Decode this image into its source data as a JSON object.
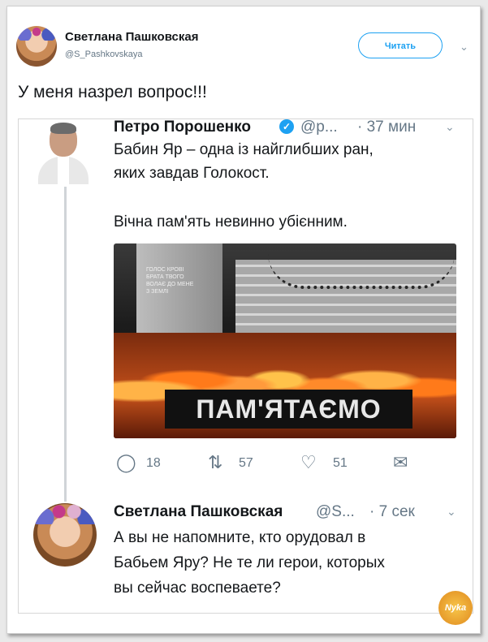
{
  "header": {
    "name": "Светлана Пашковская",
    "handle": "@S_Pashkovskaya",
    "follow_label": "Читать",
    "menu_icon": "chevron-down-icon"
  },
  "main_tweet": {
    "text": "У меня назрел вопрос!!!"
  },
  "quoted": {
    "name": "Петро Порошенко",
    "handle": "@p...",
    "time": "· 37 мин",
    "lines": [
      "Бабин Яр – одна із найглибших ран,",
      "яких завдав Голокост.",
      "Вічна пам'ять невинно убієнним."
    ],
    "image": {
      "stone_text": "ГОЛОС КРОВІ БРАТА ТВОГО ВОЛАЄ ДО МЕНЕ З ЗЕМЛІ",
      "banner": "ПАМ'ЯТАЄМО"
    },
    "actions": {
      "replies": "18",
      "retweets": "57",
      "likes": "51"
    }
  },
  "reply": {
    "name": "Светлана Пашковская",
    "handle": "@S...",
    "time": "· 7 сек",
    "lines": [
      "А вы не напомните, кто орудовал в",
      "Бабьем Яру? Не те ли герои, которых",
      "вы сейчас воспеваете?"
    ]
  },
  "watermark": "Nyka",
  "colors": {
    "accent": "#1da1f2",
    "muted": "#657786",
    "text": "#14171a"
  }
}
